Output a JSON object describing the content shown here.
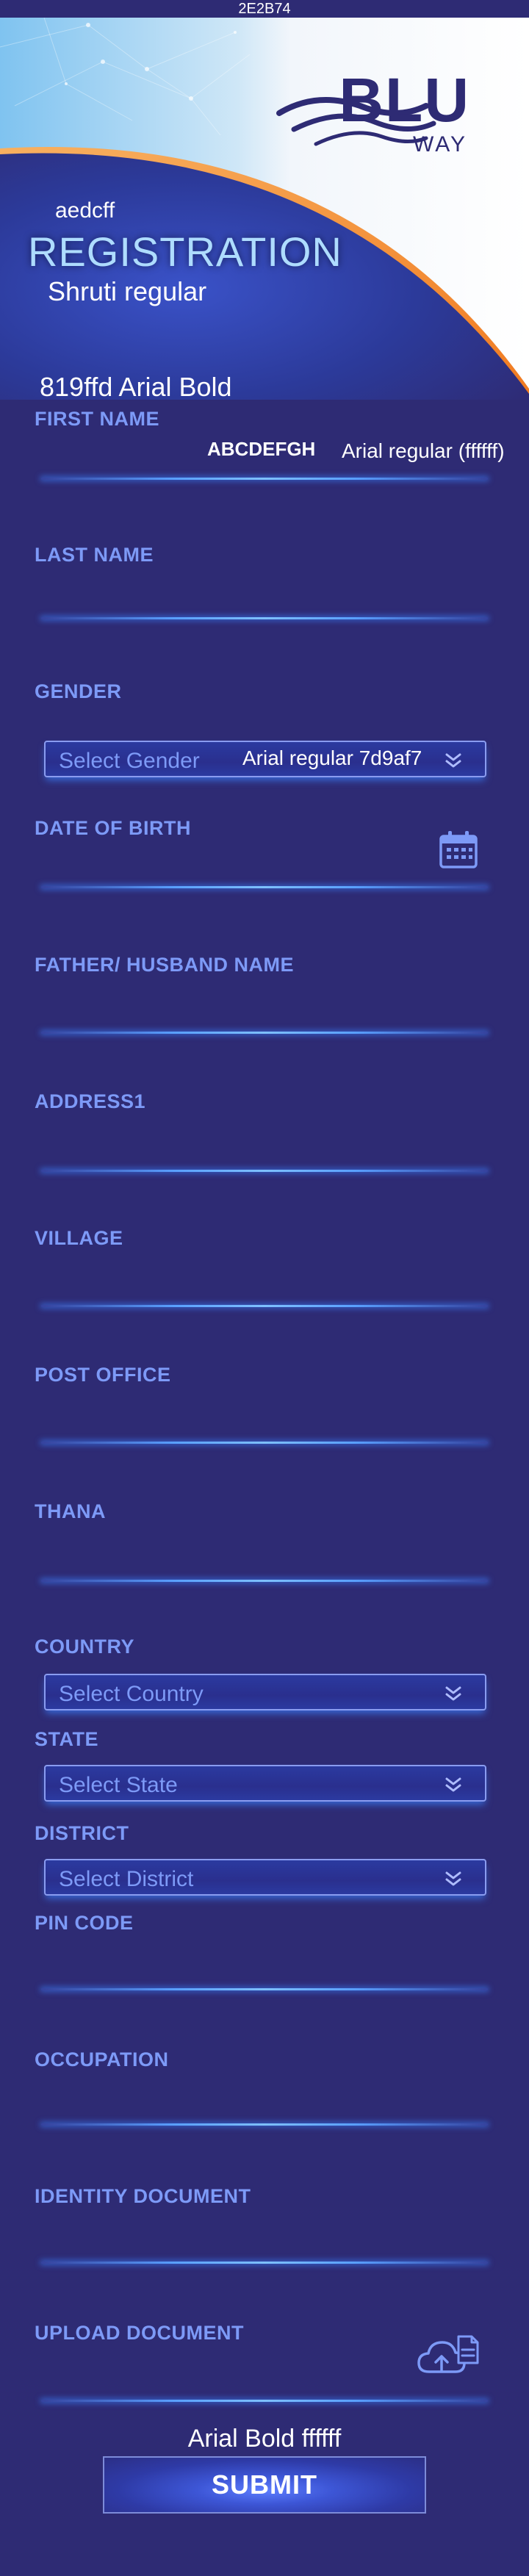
{
  "status_bar": {
    "text": "2E2B74"
  },
  "logo": {
    "brand": "BLU",
    "sub": "WAY"
  },
  "header": {
    "small_note": "aedcff",
    "title": "REGISTRATION",
    "subtitle": "Shruti regular"
  },
  "annotations": {
    "first_name_note": "819ffd Arial Bold",
    "abcdefgh": "ABCDEFGH",
    "arial_regular": "Arial regular (ffffff)",
    "select_note": "Arial regular 7d9af7",
    "submit_note": "Arial Bold ffffff"
  },
  "fields": {
    "first_name": "FIRST NAME",
    "last_name": "LAST NAME",
    "gender": "GENDER",
    "dob": "DATE OF BIRTH",
    "father_husband": "FATHER/ HUSBAND NAME",
    "address1": "ADDRESS1",
    "village": "VILLAGE",
    "post_office": "POST OFFICE",
    "thana": "THANA",
    "country": "COUNTRY",
    "state": "STATE",
    "district": "DISTRICT",
    "pin_code": "PIN CODE",
    "occupation": "OCCUPATION",
    "identity_document": "IDENTITY DOCUMENT",
    "upload_document": "UPLOAD DOCUMENT"
  },
  "selects": {
    "gender": "Select Gender",
    "country": "Select Country",
    "state": "Select State",
    "district": "Select District"
  },
  "submit": {
    "label": "SUBMIT"
  },
  "colors": {
    "background": "#2e2b74",
    "label": "#7d9af7",
    "title": "#aedcff",
    "text": "#ffffff",
    "accent_line": "#5aa0ff",
    "hero_arc": "#f59a3c"
  },
  "icons": {
    "calendar": "calendar-icon",
    "chevron": "chevron-double-down-icon",
    "upload": "cloud-upload-icon"
  }
}
